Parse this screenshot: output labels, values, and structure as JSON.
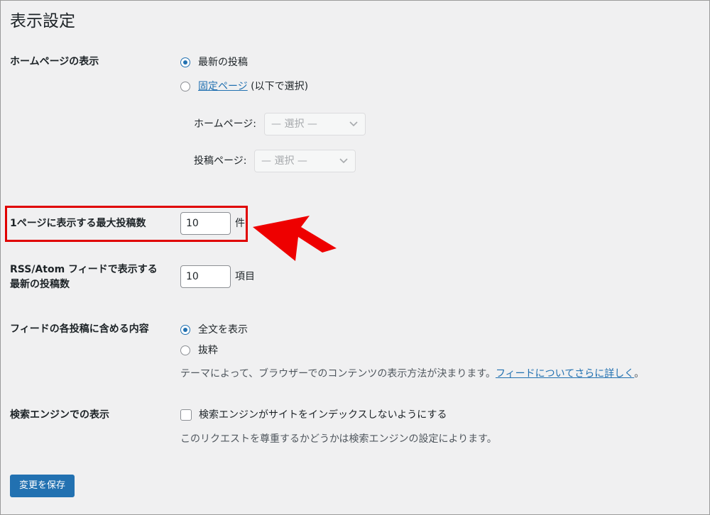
{
  "page_title": "表示設定",
  "homepage_display": {
    "label": "ホームページの表示",
    "option_latest": "最新の投稿",
    "option_static_link": "固定ページ",
    "option_static_suffix": " (以下で選択)",
    "homepage_select_label": "ホームページ:",
    "homepage_select_value": "— 選択 —",
    "posts_select_label": "投稿ページ:",
    "posts_select_value": "— 選択 —"
  },
  "posts_per_page": {
    "label": "1ページに表示する最大投稿数",
    "value": "10",
    "unit": "件"
  },
  "rss_posts": {
    "label_line1": "RSS/Atom フィードで表示する",
    "label_line2": "最新の投稿数",
    "value": "10",
    "unit": "項目"
  },
  "feed_content": {
    "label": "フィードの各投稿に含める内容",
    "option_full": "全文を表示",
    "option_excerpt": "抜粋",
    "description": "テーマによって、ブラウザーでのコンテンツの表示方法が決まります。",
    "learn_more_link": "フィードについてさらに詳しく",
    "description_end": "。"
  },
  "search_engine": {
    "label": "検索エンジンでの表示",
    "checkbox_label": "検索エンジンがサイトをインデックスしないようにする",
    "description": "このリクエストを尊重するかどうかは検索エンジンの設定によります。"
  },
  "save_button": "変更を保存",
  "colors": {
    "highlight": "#e00000",
    "accent": "#2271b1"
  }
}
